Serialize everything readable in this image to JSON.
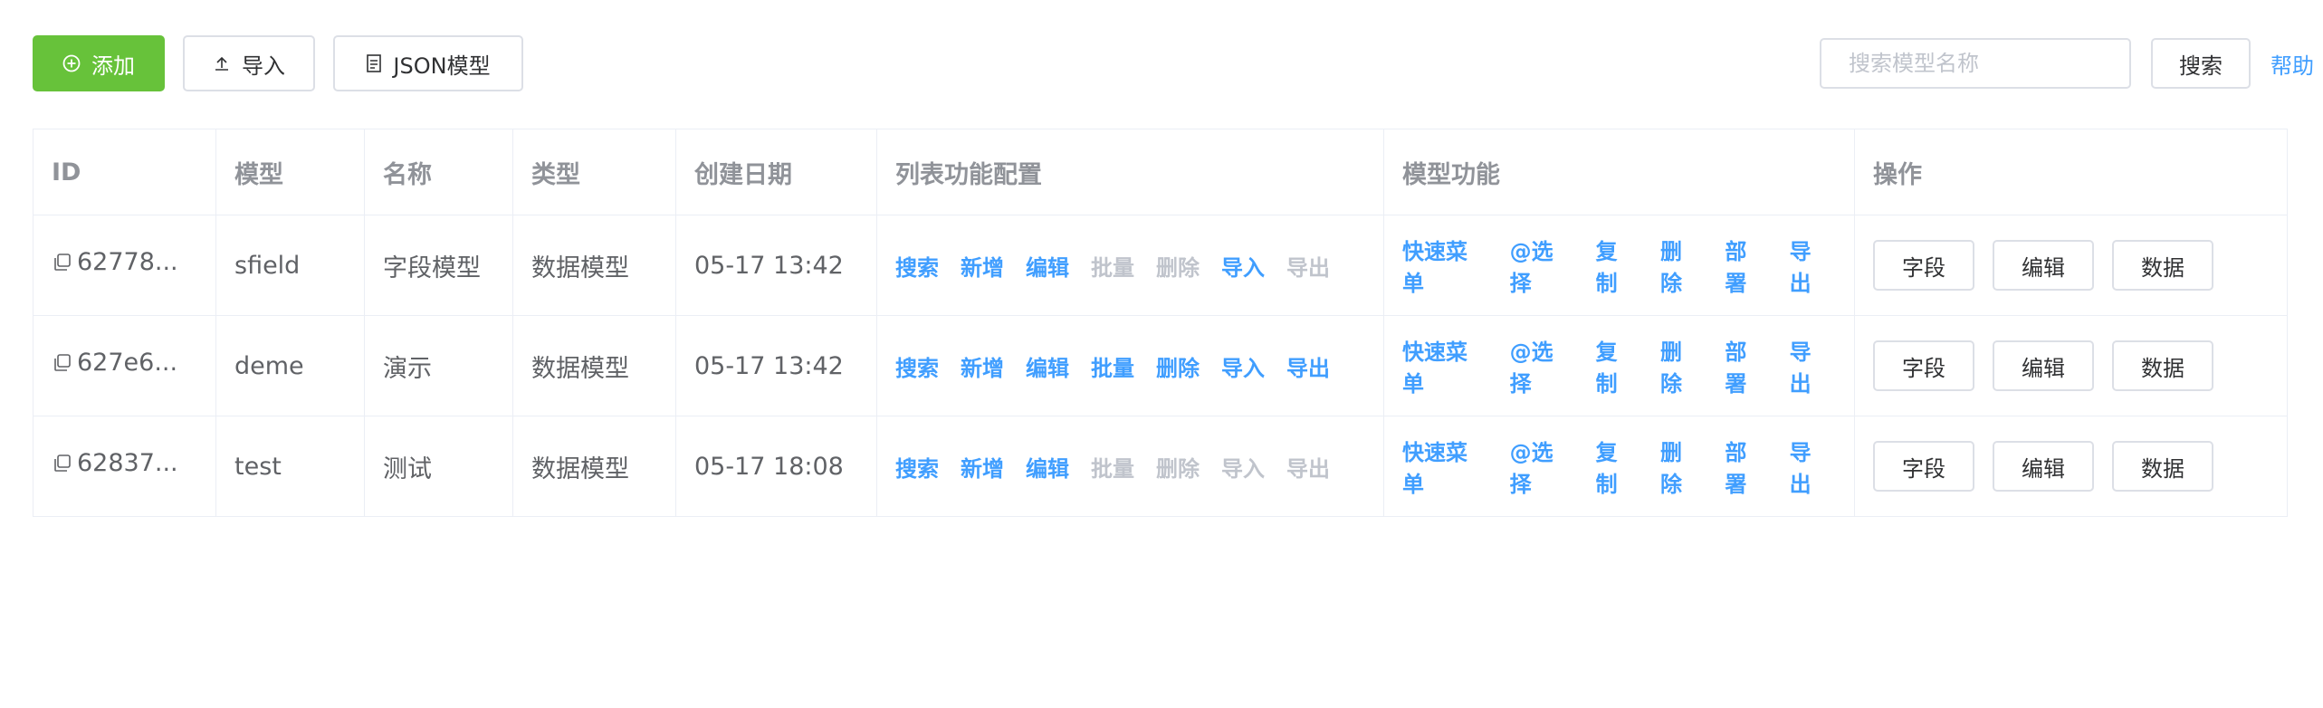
{
  "toolbar": {
    "add_label": "添加",
    "import_label": "导入",
    "json_label": "JSON模型",
    "search_placeholder": "搜索模型名称",
    "search_button": "搜索",
    "help": "帮助",
    "accent": "#67c23a",
    "link_color": "#409eff"
  },
  "table": {
    "headers": [
      "ID",
      "模型",
      "名称",
      "类型",
      "创建日期",
      "列表功能配置",
      "模型功能",
      "操作"
    ],
    "rows": [
      {
        "id": "62778...",
        "model": "sfield",
        "name": "字段模型",
        "type": "数据模型",
        "date": "05-17 13:42",
        "list_actions": [
          {
            "label": "搜索",
            "enabled": true
          },
          {
            "label": "新增",
            "enabled": true
          },
          {
            "label": "编辑",
            "enabled": true
          },
          {
            "label": "批量",
            "enabled": false
          },
          {
            "label": "删除",
            "enabled": false
          },
          {
            "label": "导入",
            "enabled": true
          },
          {
            "label": "导出",
            "enabled": false
          }
        ],
        "model_actions": [
          "快速菜单",
          "@选择",
          "复制",
          "删除",
          "部署",
          "导出"
        ],
        "ops": [
          "字段",
          "编辑",
          "数据"
        ]
      },
      {
        "id": "627e6...",
        "model": "deme",
        "name": "演示",
        "type": "数据模型",
        "date": "05-17 13:42",
        "list_actions": [
          {
            "label": "搜索",
            "enabled": true
          },
          {
            "label": "新增",
            "enabled": true
          },
          {
            "label": "编辑",
            "enabled": true
          },
          {
            "label": "批量",
            "enabled": true
          },
          {
            "label": "删除",
            "enabled": true
          },
          {
            "label": "导入",
            "enabled": true
          },
          {
            "label": "导出",
            "enabled": true
          }
        ],
        "model_actions": [
          "快速菜单",
          "@选择",
          "复制",
          "删除",
          "部署",
          "导出"
        ],
        "ops": [
          "字段",
          "编辑",
          "数据"
        ]
      },
      {
        "id": "62837...",
        "model": "test",
        "name": "测试",
        "type": "数据模型",
        "date": "05-17 18:08",
        "list_actions": [
          {
            "label": "搜索",
            "enabled": true
          },
          {
            "label": "新增",
            "enabled": true
          },
          {
            "label": "编辑",
            "enabled": true
          },
          {
            "label": "批量",
            "enabled": false
          },
          {
            "label": "删除",
            "enabled": false
          },
          {
            "label": "导入",
            "enabled": false
          },
          {
            "label": "导出",
            "enabled": false
          }
        ],
        "model_actions": [
          "快速菜单",
          "@选择",
          "复制",
          "删除",
          "部署",
          "导出"
        ],
        "ops": [
          "字段",
          "编辑",
          "数据"
        ]
      }
    ]
  }
}
